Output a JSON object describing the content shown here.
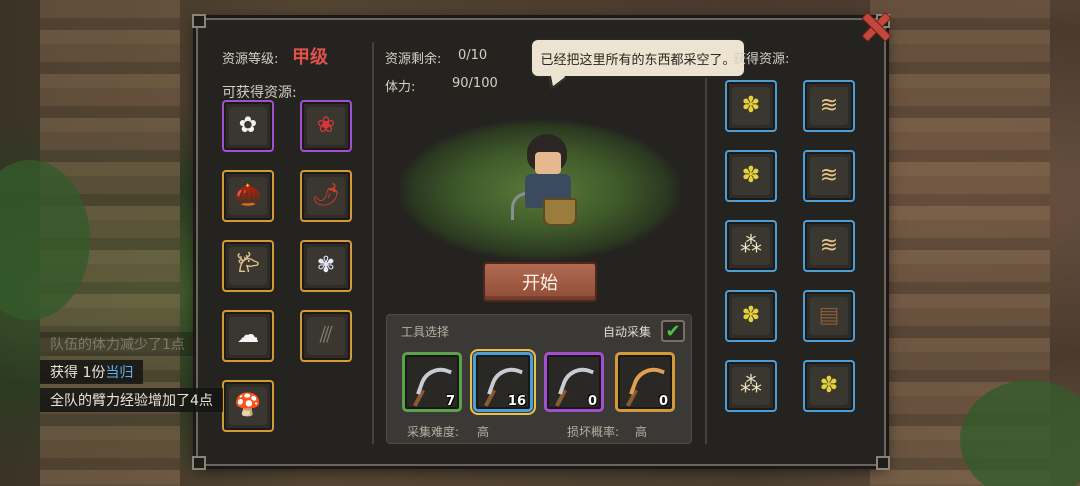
{
  "grade": {
    "label": "资源等级:",
    "value": "甲级"
  },
  "obtainable_label": "可获得资源:",
  "stats": {
    "remaining_label": "资源剩余:",
    "remaining_value": "0/10",
    "stamina_label": "体力:",
    "stamina_value": "90/100"
  },
  "speech": "已经把这里所有的东西都采空了。",
  "right_title": "获得资源:",
  "start_label": "开始",
  "tools": {
    "title": "工具选择",
    "auto_label": "自动采集",
    "auto_checked": "✔",
    "items": [
      {
        "count": "7",
        "rarity": "green"
      },
      {
        "count": "16",
        "rarity": "blue"
      },
      {
        "count": "0",
        "rarity": "purple"
      },
      {
        "count": "0",
        "rarity": "orange"
      }
    ],
    "difficulty_label": "采集难度:",
    "difficulty_value": "高",
    "break_label": "损坏概率:",
    "break_value": "高"
  },
  "left_resources": [
    {
      "icon": "white-flower-icon",
      "glyph": "✿",
      "rarity": "purple"
    },
    {
      "icon": "red-flower-icon",
      "glyph": "❀",
      "rarity": "purple"
    },
    {
      "icon": "root-icon",
      "glyph": "🌰",
      "rarity": "orange"
    },
    {
      "icon": "red-herb-icon",
      "glyph": "🌶",
      "rarity": "orange"
    },
    {
      "icon": "ginseng-icon",
      "glyph": "𐂂",
      "rarity": "orange"
    },
    {
      "icon": "wildflower-icon",
      "glyph": "✾",
      "rarity": "orange"
    },
    {
      "icon": "cotton-icon",
      "glyph": "☁",
      "rarity": "orange"
    },
    {
      "icon": "wood-sticks-icon",
      "glyph": "⫻",
      "rarity": "orange"
    },
    {
      "icon": "mushroom-icon",
      "glyph": "🍄",
      "rarity": "orange"
    }
  ],
  "right_resources": [
    {
      "icon": "yellow-flower-icon",
      "glyph": "✽"
    },
    {
      "icon": "wood-chips-icon",
      "glyph": "≋"
    },
    {
      "icon": "yellow-flower-icon",
      "glyph": "✽"
    },
    {
      "icon": "wood-chips-icon",
      "glyph": "≋"
    },
    {
      "icon": "seeds-icon",
      "glyph": "⁂"
    },
    {
      "icon": "wood-chips-icon",
      "glyph": "≋"
    },
    {
      "icon": "yellow-flower-icon",
      "glyph": "✽"
    },
    {
      "icon": "bark-icon",
      "glyph": "▤"
    },
    {
      "icon": "seeds-icon",
      "glyph": "⁂"
    },
    {
      "icon": "yellow-flower-icon",
      "glyph": "✽"
    }
  ],
  "log": {
    "faded": "队伍的体力减少了1点",
    "obtained_prefix": "获得 1份",
    "obtained_item": "当归",
    "exp": "全队的臂力经验增加了4点"
  },
  "colors": {
    "grade": "#e0524a",
    "highlight": "#5fb2ef",
    "warn": "#e39a3a",
    "check": "#4ec23f"
  }
}
